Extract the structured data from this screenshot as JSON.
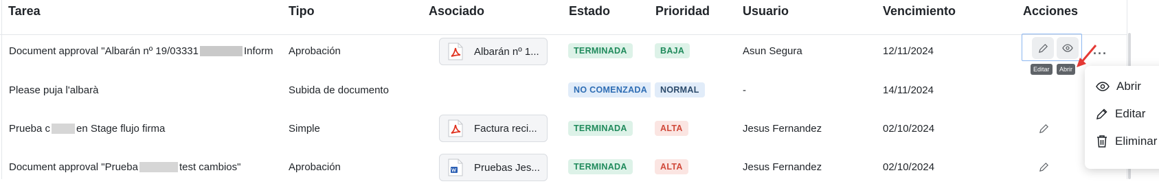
{
  "columns": [
    "Tarea",
    "Tipo",
    "Asociado",
    "Estado",
    "Prioridad",
    "Usuario",
    "Vencimiento",
    "Acciones"
  ],
  "rows": [
    {
      "tarea_pre": "Document approval \"Albarán nº 19/03331",
      "tarea_post": "Inform",
      "tipo": "Aprobación",
      "asociado": "Albarán nº 1...",
      "asociado_icon": "pdf-file-icon",
      "estado": "TERMINADA",
      "prioridad": "BAJA",
      "usuario": "Asun Segura",
      "vencimiento": "12/11/2024"
    },
    {
      "tarea_pre": "Please puja l'albarà",
      "tarea_post": "",
      "tipo": "Subida de documento",
      "asociado": "",
      "asociado_icon": "",
      "estado": "NO COMENZADA",
      "prioridad": "NORMAL",
      "usuario": "-",
      "vencimiento": "14/11/2024"
    },
    {
      "tarea_pre": "Prueba c",
      "tarea_post": "en Stage flujo firma",
      "tipo": "Simple",
      "asociado": "Factura reci...",
      "asociado_icon": "pdf-file-icon",
      "estado": "TERMINADA",
      "prioridad": "ALTA",
      "usuario": "Jesus Fernandez",
      "vencimiento": "02/10/2024"
    },
    {
      "tarea_pre": "Document approval \"Prueba",
      "tarea_post": "test cambios\"",
      "tipo": "Aprobación",
      "asociado": "Pruebas Jes...",
      "asociado_icon": "word-file-icon",
      "estado": "TERMINADA",
      "prioridad": "ALTA",
      "usuario": "Jesus Fernandez",
      "vencimiento": "02/10/2024"
    }
  ],
  "tooltips": {
    "edit": "Editar",
    "open": "Abrir"
  },
  "context_menu": {
    "open": "Abrir",
    "edit": "Editar",
    "delete": "Eliminar"
  },
  "colors": {
    "done": "#1f8a5b",
    "todo": "#2e6db4",
    "high": "#d0493a",
    "pdf": "#e0321f",
    "word": "#2b5fb4",
    "annotation_arrow": "#e53935"
  }
}
